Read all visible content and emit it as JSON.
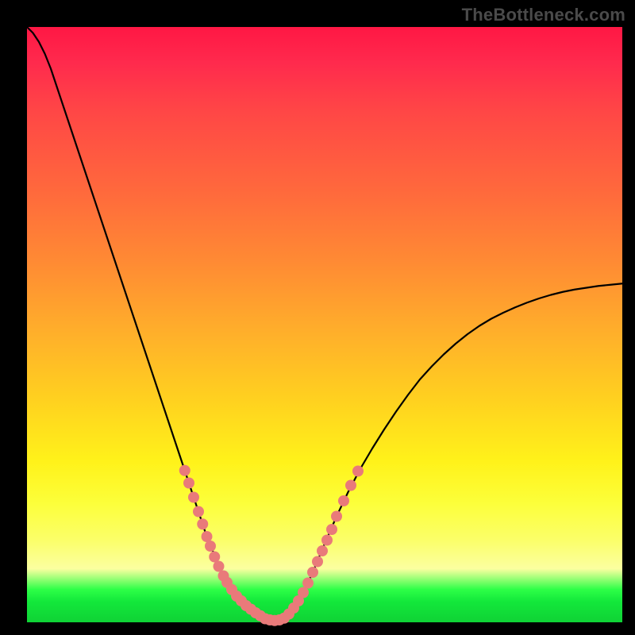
{
  "watermark": "TheBottleneck.com",
  "colors": {
    "frame": "#000000",
    "curve": "#000000",
    "dots": "#e97a7a",
    "dots_stroke": "#c95a5a"
  },
  "chart_data": {
    "type": "line",
    "title": "",
    "xlabel": "",
    "ylabel": "",
    "xlim": [
      0,
      100
    ],
    "ylim": [
      0,
      100
    ],
    "x": [
      0,
      1,
      2,
      3,
      4,
      5,
      6,
      7,
      8,
      9,
      10,
      11,
      12,
      13,
      14,
      15,
      16,
      17,
      18,
      19,
      20,
      21,
      22,
      23,
      24,
      25,
      26,
      27,
      28,
      29,
      30,
      31,
      32,
      33,
      34,
      35,
      36,
      37,
      38,
      39,
      40,
      41,
      42,
      43,
      44,
      45,
      46,
      47,
      48,
      49,
      50,
      52,
      54,
      56,
      58,
      60,
      62,
      64,
      66,
      68,
      70,
      72,
      74,
      76,
      78,
      80,
      82,
      84,
      86,
      88,
      90,
      92,
      94,
      96,
      98,
      100
    ],
    "values": [
      100,
      99,
      97.5,
      95.5,
      93,
      90,
      87,
      84,
      81,
      78,
      75,
      72,
      69,
      66,
      63,
      60,
      57,
      54,
      51,
      48,
      45,
      42,
      39,
      36,
      33,
      30,
      27,
      24,
      21,
      18,
      15,
      12.5,
      10,
      8,
      6,
      4.5,
      3.2,
      2.2,
      1.4,
      0.8,
      0.4,
      0.2,
      0.2,
      0.6,
      1.4,
      2.6,
      4.2,
      6.2,
      8.4,
      10.8,
      13.2,
      17.8,
      22.0,
      25.8,
      29.2,
      32.4,
      35.4,
      38.2,
      40.8,
      43.0,
      45.0,
      46.8,
      48.4,
      49.8,
      51.0,
      52.0,
      52.9,
      53.7,
      54.4,
      55.0,
      55.5,
      55.9,
      56.2,
      56.5,
      56.7,
      56.9
    ],
    "highlight_points_x": [
      26.5,
      27.2,
      28.0,
      28.8,
      29.5,
      30.2,
      30.8,
      31.5,
      32.2,
      33.0,
      33.6,
      34.4,
      35.2,
      36.0,
      36.8,
      37.6,
      38.4,
      39.2,
      40.0,
      40.8,
      41.6,
      42.4,
      43.2,
      44.0,
      44.8,
      45.6,
      46.4,
      47.2,
      48.0,
      48.8,
      49.6,
      50.4,
      51.2,
      52.0,
      53.2,
      54.4,
      55.6
    ],
    "highlight_points_y": [
      25.5,
      23.4,
      21.0,
      18.6,
      16.5,
      14.4,
      12.8,
      11.0,
      9.4,
      7.8,
      6.7,
      5.5,
      4.4,
      3.6,
      2.8,
      2.2,
      1.6,
      1.1,
      0.6,
      0.4,
      0.3,
      0.4,
      0.7,
      1.4,
      2.4,
      3.6,
      5.0,
      6.6,
      8.4,
      10.2,
      12.0,
      13.8,
      15.6,
      17.8,
      20.4,
      23.0,
      25.4
    ]
  }
}
